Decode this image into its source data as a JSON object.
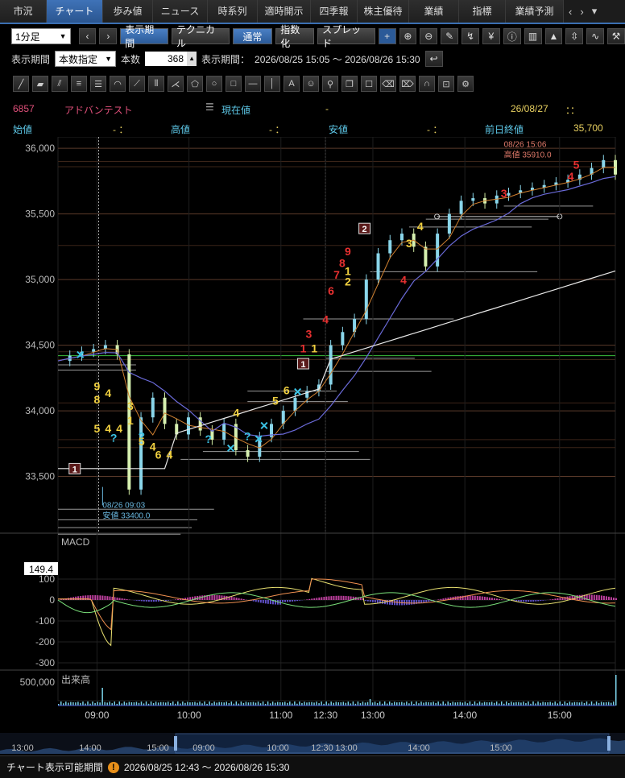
{
  "tabs": [
    {
      "label": "市況",
      "w": 0
    },
    {
      "label": "チャート"
    },
    {
      "label": "歩み値"
    },
    {
      "label": "ニュース"
    },
    {
      "label": "時系列"
    },
    {
      "label": "適時開示"
    },
    {
      "label": "四季報"
    },
    {
      "label": "株主優待"
    },
    {
      "label": "業績"
    },
    {
      "label": "指標"
    },
    {
      "label": "業績予測"
    }
  ],
  "active_tab": "チャート",
  "toolbar": {
    "interval": "1分足",
    "display_period": "表示期間",
    "technical": "テクニカル",
    "normal": "通常",
    "index": "指数化",
    "spread": "スプレッド"
  },
  "period": {
    "label": "表示期間",
    "mode": "本数指定",
    "count_label": "本数",
    "count": "368",
    "range_label": "表示期間：",
    "range": "2026/08/25 15:05 ～ 2026/08/26 15:30"
  },
  "quote": {
    "code": "6857",
    "name": "アドバンテスト",
    "current_label": "現在値",
    "current_value": "-",
    "date": "26/08/27",
    "time": "：：",
    "open_label": "始値",
    "open_value": "- ：",
    "high_label": "高値",
    "high_value": "- ：",
    "low_label": "安値",
    "low_value": "- ：",
    "prev_close_label": "前日終値",
    "prev_close_value": "35,700"
  },
  "chart_data": {
    "type": "line",
    "price_axis": [
      "36,000",
      "35,500",
      "35,000",
      "34,500",
      "34,000",
      "33,500"
    ],
    "price_range": [
      33080,
      36050
    ],
    "time_labels": [
      "09:00",
      "10:00",
      "11:00",
      "12:30",
      "13:00",
      "14:00",
      "15:00"
    ],
    "high_annotation": {
      "time": "08/26 15:06",
      "text": "高値 35910.0"
    },
    "low_annotation": {
      "time": "08/26 09:03",
      "text": "安値 33400.0"
    },
    "price_series": [
      34380,
      34420,
      34450,
      34470,
      34500,
      34430,
      33400,
      33950,
      34100,
      33900,
      33820,
      33950,
      33850,
      33780,
      33900,
      33700,
      33650,
      33800,
      33900,
      34000,
      34100,
      34150,
      34200,
      34500,
      34600,
      34700,
      35000,
      35200,
      35300,
      35350,
      35250,
      35100,
      35350,
      35500,
      35600,
      35620,
      35580,
      35640,
      35660,
      35680,
      35700,
      35720,
      35740,
      35760,
      35800,
      35850,
      35910,
      35800
    ],
    "macd_axis": [
      "100",
      "0",
      "-100",
      "-200",
      "-300"
    ],
    "macd_current": "149.4",
    "macd_label": "MACD",
    "volume_label": "出来高",
    "volume_axis": "500,000",
    "markers": [
      {
        "t": 0.03,
        "p": 33550,
        "text": "1",
        "kind": "box"
      },
      {
        "t": 0.44,
        "p": 34350,
        "text": "1",
        "kind": "box"
      },
      {
        "t": 0.55,
        "p": 35380,
        "text": "2",
        "kind": "box"
      },
      {
        "t": 0.07,
        "p": 34180,
        "text": "9",
        "kind": "y"
      },
      {
        "t": 0.07,
        "p": 34080,
        "text": "8",
        "kind": "y"
      },
      {
        "t": 0.09,
        "p": 34130,
        "text": "4",
        "kind": "y"
      },
      {
        "t": 0.13,
        "p": 34030,
        "text": "3",
        "kind": "y"
      },
      {
        "t": 0.07,
        "p": 33860,
        "text": "5",
        "kind": "y"
      },
      {
        "t": 0.09,
        "p": 33860,
        "text": "4",
        "kind": "y"
      },
      {
        "t": 0.11,
        "p": 33860,
        "text": "4",
        "kind": "y"
      },
      {
        "t": 0.13,
        "p": 33920,
        "text": "1",
        "kind": "y"
      },
      {
        "t": 0.15,
        "p": 33760,
        "text": "5",
        "kind": "y"
      },
      {
        "t": 0.17,
        "p": 33720,
        "text": "4",
        "kind": "y"
      },
      {
        "t": 0.18,
        "p": 33660,
        "text": "6",
        "kind": "y"
      },
      {
        "t": 0.2,
        "p": 33660,
        "text": "4",
        "kind": "y"
      },
      {
        "t": 0.32,
        "p": 33980,
        "text": "4",
        "kind": "y"
      },
      {
        "t": 0.39,
        "p": 34070,
        "text": "5",
        "kind": "y"
      },
      {
        "t": 0.41,
        "p": 34150,
        "text": "6",
        "kind": "y"
      },
      {
        "t": 0.52,
        "p": 35060,
        "text": "1",
        "kind": "y"
      },
      {
        "t": 0.52,
        "p": 34980,
        "text": "2",
        "kind": "y"
      },
      {
        "t": 0.63,
        "p": 35270,
        "text": "3",
        "kind": "y"
      },
      {
        "t": 0.65,
        "p": 35400,
        "text": "4",
        "kind": "y"
      },
      {
        "t": 0.44,
        "p": 34470,
        "text": "1",
        "kind": "r"
      },
      {
        "t": 0.46,
        "p": 34470,
        "text": "1",
        "kind": "y"
      },
      {
        "t": 0.45,
        "p": 34580,
        "text": "3",
        "kind": "r"
      },
      {
        "t": 0.48,
        "p": 34690,
        "text": "4",
        "kind": "r"
      },
      {
        "t": 0.49,
        "p": 34910,
        "text": "6",
        "kind": "r"
      },
      {
        "t": 0.5,
        "p": 35030,
        "text": "7",
        "kind": "r"
      },
      {
        "t": 0.51,
        "p": 35120,
        "text": "8",
        "kind": "r"
      },
      {
        "t": 0.52,
        "p": 35210,
        "text": "9",
        "kind": "r"
      },
      {
        "t": 0.62,
        "p": 34990,
        "text": "4",
        "kind": "r"
      },
      {
        "t": 0.8,
        "p": 35650,
        "text": "3",
        "kind": "r"
      },
      {
        "t": 0.92,
        "p": 35780,
        "text": "4",
        "kind": "r"
      },
      {
        "t": 0.93,
        "p": 35870,
        "text": "5",
        "kind": "r"
      },
      {
        "t": 0.04,
        "p": 34420,
        "text": "✕",
        "kind": "c"
      },
      {
        "t": 0.31,
        "p": 33710,
        "text": "✕",
        "kind": "c"
      },
      {
        "t": 0.36,
        "p": 33780,
        "text": "✕",
        "kind": "c"
      },
      {
        "t": 0.37,
        "p": 33880,
        "text": "✕",
        "kind": "c"
      },
      {
        "t": 0.43,
        "p": 34140,
        "text": "✕",
        "kind": "c"
      },
      {
        "t": 0.1,
        "p": 33790,
        "text": "?",
        "kind": "c"
      },
      {
        "t": 0.15,
        "p": 33800,
        "text": "?",
        "kind": "c"
      },
      {
        "t": 0.27,
        "p": 33780,
        "text": "?",
        "kind": "c"
      },
      {
        "t": 0.34,
        "p": 33800,
        "text": "?",
        "kind": "c"
      }
    ]
  },
  "navigator": {
    "labels": [
      "13:00",
      "14:00",
      "15:00",
      "09:00",
      "10:00",
      "12:30",
      "13:00",
      "14:00",
      "15:00"
    ]
  },
  "footer": {
    "label": "チャート表示可能期間",
    "range": "2026/08/25 12:43 ～ 2026/08/26 15:30"
  },
  "colors": {
    "accent": "#3f73b8",
    "up": "#7ad2e8",
    "pink": "#e0507a",
    "yellow": "#e8d060",
    "red": "#e83030",
    "cyan": "#3bc4e6"
  }
}
